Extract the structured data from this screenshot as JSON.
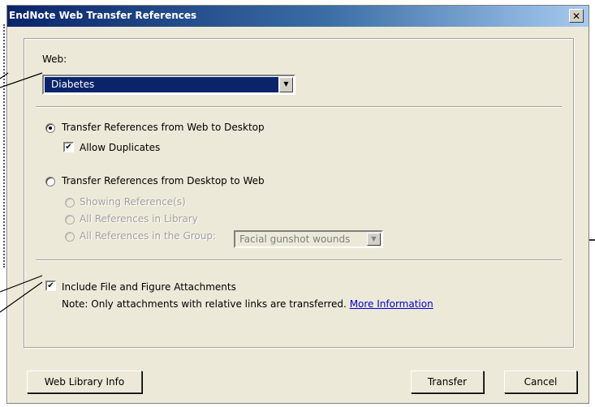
{
  "dialog": {
    "title": "EndNote Web Transfer References",
    "close_symbol": "✕"
  },
  "web": {
    "label": "Web:",
    "selected": "Diabetes"
  },
  "transfer_web_to_desktop": {
    "label": "Transfer References from Web to Desktop",
    "checked": true,
    "allow_duplicates_label": "Allow Duplicates",
    "allow_duplicates_checked": true
  },
  "transfer_desktop_to_web": {
    "label": "Transfer References from Desktop to Web",
    "checked": false,
    "options": [
      "Showing Reference(s)",
      "All References in Library",
      "All References in the Group:"
    ],
    "group_selected": "Facial gunshot wounds"
  },
  "attachments": {
    "label": "Include File and Figure Attachments",
    "checked": true,
    "note": "Note: Only attachments with relative links are transferred.",
    "more_info_link": "More Information"
  },
  "buttons": {
    "web_library_info": "Web Library Info",
    "transfer": "Transfer",
    "cancel": "Cancel"
  },
  "icons": {
    "dropdown_arrow": "▼",
    "check_mark": "✔"
  },
  "colors": {
    "title_gradient_start": "#0a246a",
    "selection_highlight": "#0a246a",
    "dialog_face": "#ece9d8",
    "link": "#0000cc"
  }
}
